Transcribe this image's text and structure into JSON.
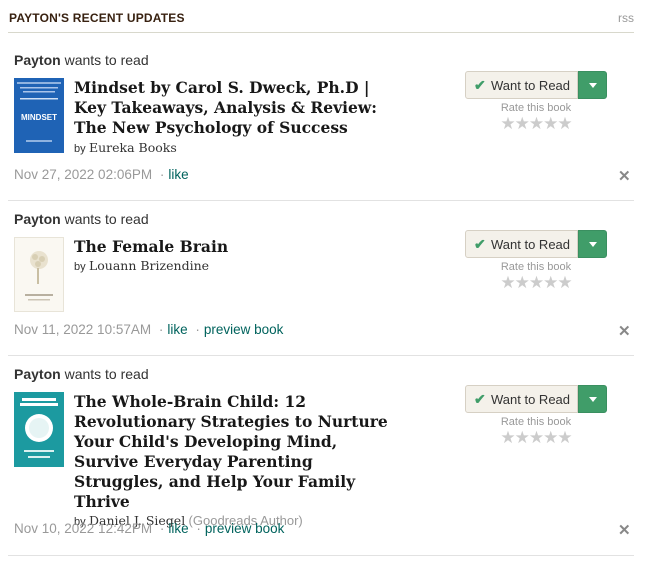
{
  "header": {
    "title": "PAYTON'S RECENT UPDATES",
    "rss": "rss"
  },
  "common": {
    "want_to_read": "Want to Read",
    "rate_label": "Rate this book",
    "stars": "★★★★★",
    "check": "✔",
    "close": "✕",
    "by": "by"
  },
  "updates": [
    {
      "user": "Payton",
      "action": "wants to read",
      "title": "Mindset by Carol S. Dweck, Ph.D | Key Takeaways, Analysis & Review: The New Psychology of Success",
      "author": "Eureka Books",
      "author_note": "",
      "timestamp": "Nov 27, 2022 02:06PM",
      "like": "like",
      "preview": "",
      "cover": {
        "bg": "#1f63b5",
        "text": "MINDSET"
      }
    },
    {
      "user": "Payton",
      "action": "wants to read",
      "title": "The Female Brain",
      "author": "Louann Brizendine",
      "author_note": "",
      "timestamp": "Nov 11, 2022 10:57AM",
      "like": "like",
      "preview": "preview book",
      "cover": {
        "bg": "#faf8f2",
        "text": "THE FEMALE BRAIN"
      }
    },
    {
      "user": "Payton",
      "action": "wants to read",
      "title": "The Whole-Brain Child: 12 Revolutionary Strategies to Nurture Your Child's Developing Mind, Survive Everyday Parenting Struggles, and Help Your Family Thrive",
      "author": "Daniel J. Siegel",
      "author_note": "(Goodreads Author)",
      "timestamp": "Nov 10, 2022 12:42PM",
      "like": "like",
      "preview": "preview book",
      "cover": {
        "bg": "#1c9aa0",
        "text": "THE WHOLE-BRAIN CHILD"
      }
    }
  ],
  "colors": {
    "accent_green": "#409d69",
    "link": "#00635d",
    "button_bg": "#f4f1ea"
  }
}
